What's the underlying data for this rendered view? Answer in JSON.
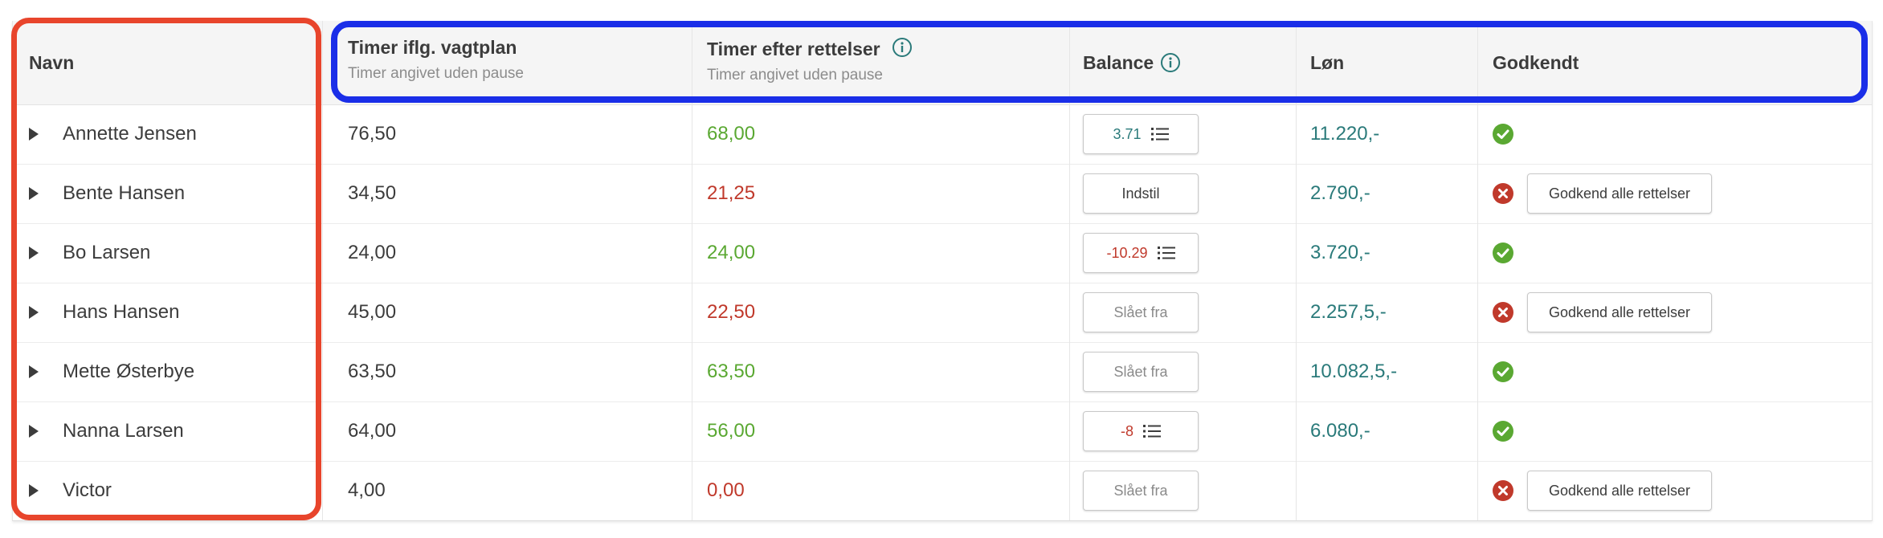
{
  "colors": {
    "green": "#5aa832",
    "red": "#c0392b",
    "teal": "#2a7a7a",
    "highlight_red": "#e8452c",
    "highlight_blue": "#1a2ee8"
  },
  "header": {
    "navn": "Navn",
    "timer_vagtplan": "Timer iflg. vagtplan",
    "timer_vagtplan_sub": "Timer angivet uden pause",
    "timer_rettelser": "Timer efter rettelser",
    "timer_rettelser_sub": "Timer angivet uden pause",
    "balance": "Balance",
    "loen": "Løn",
    "godkendt": "Godkendt"
  },
  "rows": [
    {
      "name": "Annette Jensen",
      "vagtplan": "76,50",
      "rettelser": "68,00",
      "rettelser_color": "green",
      "balance": "3.71",
      "balance_type": "list",
      "balance_color": "teal",
      "loen": "11.220,-",
      "approved": true
    },
    {
      "name": "Bente Hansen",
      "vagtplan": "34,50",
      "rettelser": "21,25",
      "rettelser_color": "red",
      "balance": "Indstil",
      "balance_type": "action",
      "balance_color": "dark",
      "loen": "2.790,-",
      "approved": false,
      "approve_label": "Godkend alle rettelser"
    },
    {
      "name": "Bo Larsen",
      "vagtplan": "24,00",
      "rettelser": "24,00",
      "rettelser_color": "green",
      "balance": "-10.29",
      "balance_type": "list",
      "balance_color": "red",
      "loen": "3.720,-",
      "approved": true
    },
    {
      "name": "Hans Hansen",
      "vagtplan": "45,00",
      "rettelser": "22,50",
      "rettelser_color": "red",
      "balance": "Slået fra",
      "balance_type": "disabled",
      "balance_color": "gray",
      "loen": "2.257,5,-",
      "approved": false,
      "approve_label": "Godkend alle rettelser"
    },
    {
      "name": "Mette Østerbye",
      "vagtplan": "63,50",
      "rettelser": "63,50",
      "rettelser_color": "green",
      "balance": "Slået fra",
      "balance_type": "disabled",
      "balance_color": "gray",
      "loen": "10.082,5,-",
      "approved": true
    },
    {
      "name": "Nanna Larsen",
      "vagtplan": "64,00",
      "rettelser": "56,00",
      "rettelser_color": "green",
      "balance": "-8",
      "balance_type": "list",
      "balance_color": "red",
      "loen": "6.080,-",
      "approved": true
    },
    {
      "name": "Victor",
      "vagtplan": "4,00",
      "rettelser": "0,00",
      "rettelser_color": "red",
      "balance": "Slået fra",
      "balance_type": "disabled",
      "balance_color": "gray",
      "loen": "",
      "approved": false,
      "approve_label": "Godkend alle rettelser"
    }
  ]
}
